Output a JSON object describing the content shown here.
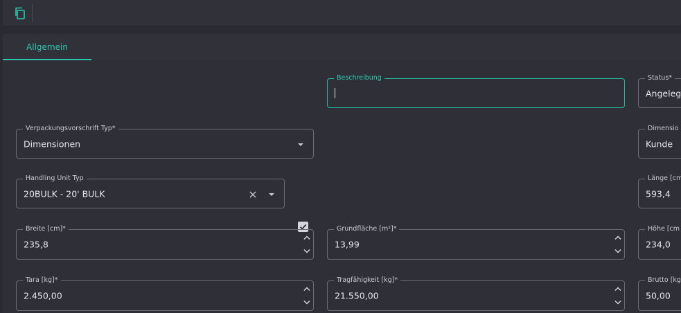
{
  "toolbar": {
    "copy_icon": "copy-icon"
  },
  "tabs": [
    {
      "label": "Allgemein",
      "active": true
    }
  ],
  "fields": {
    "beschreibung": {
      "label": "Beschreibung",
      "value": ""
    },
    "status": {
      "label": "Status*",
      "value": "Angelegt"
    },
    "verpackungsvorschrift_typ": {
      "label": "Verpackungsvorschrift Typ*",
      "value": "Dimensionen"
    },
    "dimension": {
      "label": "Dimensio",
      "value": "Kunde"
    },
    "handling_unit_typ": {
      "label": "Handling Unit Typ",
      "value": "20BULK - 20' BULK",
      "checkbox_checked": true
    },
    "laenge": {
      "label": "Länge [cm",
      "value": "593,4"
    },
    "breite": {
      "label": "Breite [cm]*",
      "value": "235,8"
    },
    "grundflaeche": {
      "label": "Grundfläche [m²]*",
      "value": "13,99"
    },
    "hoehe": {
      "label": "Höhe [cm",
      "value": "234,0"
    },
    "tara": {
      "label": "Tara [kg]*",
      "value": "2.450,00"
    },
    "tragfaehigkeit": {
      "label": "Tragfähigkeit [kg]*",
      "value": "21.550,00"
    },
    "brutto": {
      "label": "Brutto [kg",
      "value": "50,00"
    }
  },
  "colors": {
    "accent": "#2fc6b0",
    "background": "#2a2b32",
    "panel": "#2f3037"
  }
}
